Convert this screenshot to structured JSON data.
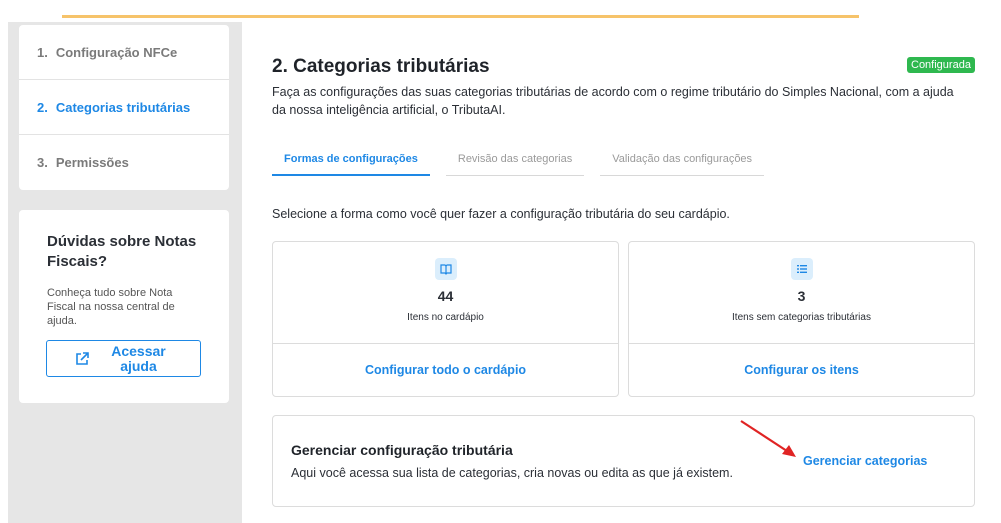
{
  "sidebar": {
    "steps": [
      {
        "num": "1.",
        "label": "Configuração NFCe"
      },
      {
        "num": "2.",
        "label": "Categorias tributárias"
      },
      {
        "num": "3.",
        "label": "Permissões"
      }
    ],
    "help": {
      "title": "Dúvidas sobre Notas Fiscais?",
      "text": "Conheça tudo sobre Nota Fiscal na nossa central de ajuda.",
      "button_label": "Acessar ajuda",
      "icon": "external-link-icon"
    }
  },
  "main": {
    "title": "2. Categorias tributárias",
    "badge": "Configurada",
    "description": "Faça as configurações das suas categorias tributárias de acordo com o regime tributário do Simples Nacional, com a ajuda da nossa inteligência artificial, o TributaAI.",
    "tabs": [
      {
        "label": "Formas de configurações",
        "active": true
      },
      {
        "label": "Revisão das categorias",
        "active": false
      },
      {
        "label": "Validação das configurações",
        "active": false
      }
    ],
    "select_prompt": "Selecione a forma como você quer fazer a configuração tributária do seu cardápio.",
    "cards": [
      {
        "icon": "book-icon",
        "count": "44",
        "label": "Itens no cardápio",
        "link": "Configurar todo o cardápio"
      },
      {
        "icon": "list-icon",
        "count": "3",
        "label": "Itens sem categorias tributárias",
        "link": "Configurar os itens"
      }
    ],
    "manage": {
      "title": "Gerenciar configuração tributária",
      "text": "Aqui você acessa sua lista de categorias, cria novas ou edita as que já existem.",
      "link": "Gerenciar categorias"
    }
  },
  "colors": {
    "accent": "#1e88e5",
    "badge": "#2fb84f",
    "top_bar": "#f6c36a",
    "annotation_arrow": "#e02424"
  }
}
